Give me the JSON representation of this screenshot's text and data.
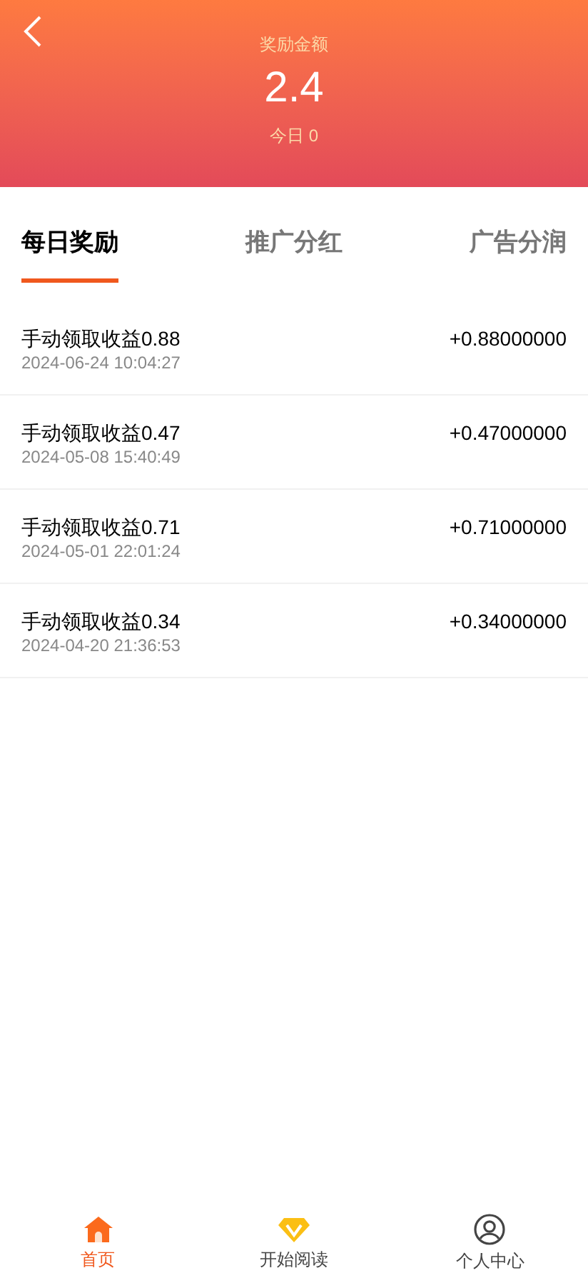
{
  "header": {
    "label": "奖励金额",
    "amount": "2.4",
    "today": "今日 0"
  },
  "tabs": [
    {
      "label": "每日奖励",
      "selected": true
    },
    {
      "label": "推广分红",
      "selected": false
    },
    {
      "label": "广告分润",
      "selected": false
    }
  ],
  "records": [
    {
      "title": "手动领取收益0.88",
      "time": "2024-06-24 10:04:27",
      "amount": "+0.88000000"
    },
    {
      "title": "手动领取收益0.47",
      "time": "2024-05-08 15:40:49",
      "amount": "+0.47000000"
    },
    {
      "title": "手动领取收益0.71",
      "time": "2024-05-01 22:01:24",
      "amount": "+0.71000000"
    },
    {
      "title": "手动领取收益0.34",
      "time": "2024-04-20 21:36:53",
      "amount": "+0.34000000"
    }
  ],
  "nav": [
    {
      "label": "首页",
      "kind": "home",
      "selected": true
    },
    {
      "label": "开始阅读",
      "kind": "diamond",
      "selected": false
    },
    {
      "label": "个人中心",
      "kind": "user",
      "selected": false
    }
  ]
}
